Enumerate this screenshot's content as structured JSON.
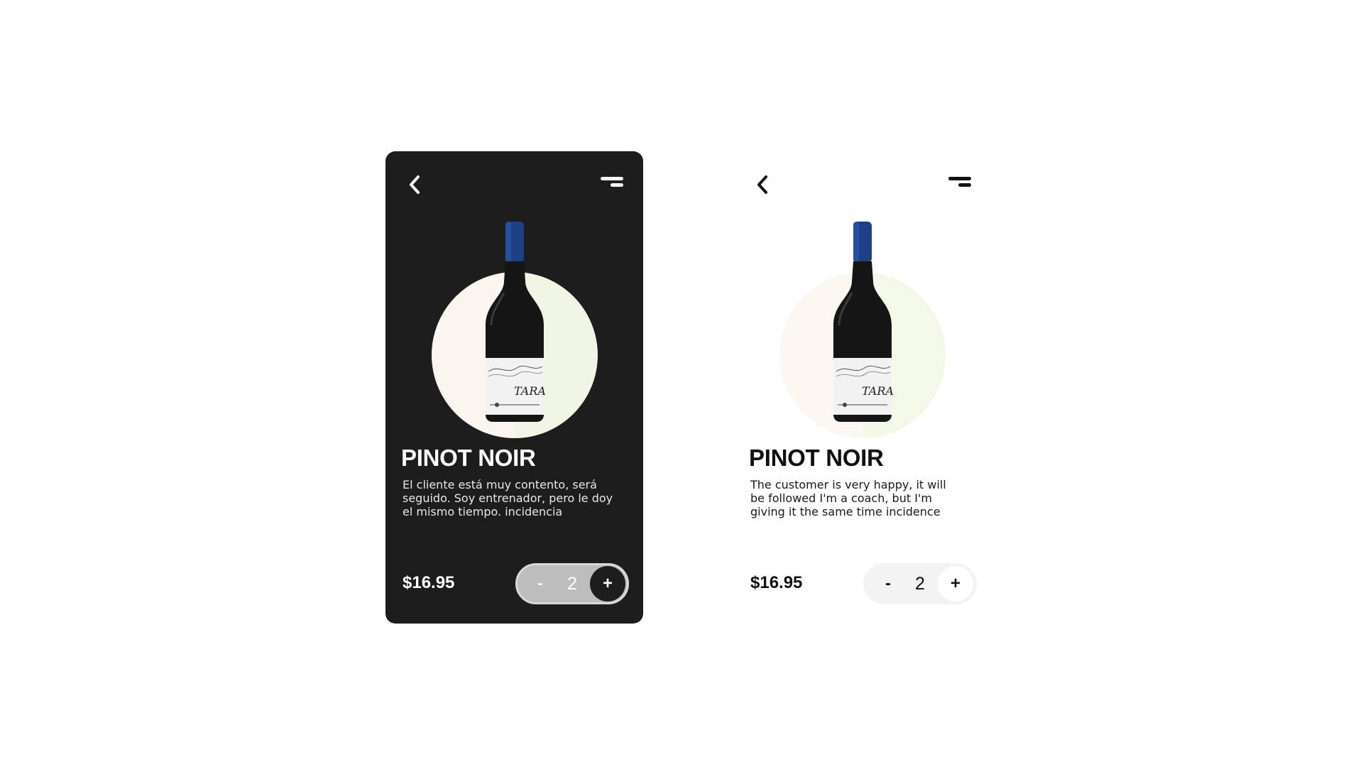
{
  "colors": {
    "dark_card_bg": "#1d1d1d",
    "light_card_bg": "#ffffff",
    "bottle_capsule": "#1f3f86",
    "bottle_glass": "#151515",
    "circle_left": "#faf6ef",
    "circle_right": "#f1f6e4"
  },
  "icons": {
    "back": "chevron-left-icon",
    "menu": "two-line-menu-icon"
  },
  "cards": [
    {
      "theme": "dark",
      "title": "PINOT NOIR",
      "description": "El cliente está muy contento, será seguido. Soy entrenador, pero le doy el mismo tiempo. incidencia",
      "price": "$16.95",
      "quantity": "2",
      "minus_label": "-",
      "plus_label": "+",
      "bottle_label": "TARA"
    },
    {
      "theme": "light",
      "title": "PINOT NOIR",
      "description": "The customer is very happy, it will be followed I'm a coach, but I'm giving it the same time incidence",
      "price": "$16.95",
      "quantity": "2",
      "minus_label": "-",
      "plus_label": "+",
      "bottle_label": "TARA"
    }
  ]
}
